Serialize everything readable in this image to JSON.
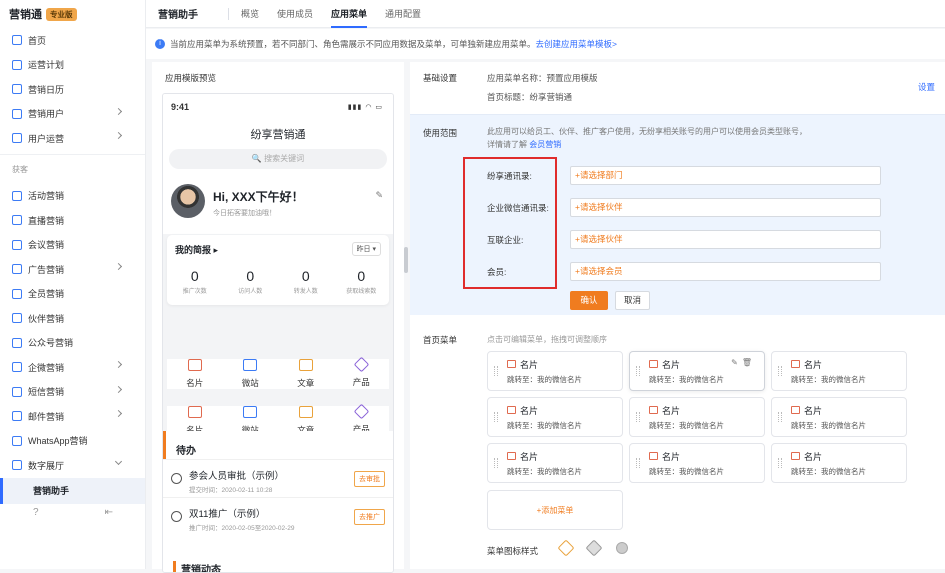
{
  "brand": {
    "name": "营销通",
    "badge": "专业版"
  },
  "sidebar": {
    "items": [
      {
        "label": "首页"
      },
      {
        "label": "运营计划"
      },
      {
        "label": "营销日历"
      },
      {
        "label": "营销用户",
        "chev": true
      },
      {
        "label": "用户运营",
        "chev": true
      }
    ],
    "group": "获客",
    "items2": [
      {
        "label": "活动营销"
      },
      {
        "label": "直播营销"
      },
      {
        "label": "会议营销"
      },
      {
        "label": "广告营销",
        "chev": true
      },
      {
        "label": "全员营销"
      },
      {
        "label": "伙伴营销"
      },
      {
        "label": "公众号营销"
      },
      {
        "label": "企微营销",
        "chev": true
      },
      {
        "label": "短信营销",
        "chev": true
      },
      {
        "label": "邮件营销",
        "chev": true
      },
      {
        "label": "WhatsApp营销"
      },
      {
        "label": "数字展厅",
        "chev": true
      }
    ],
    "sub": "营销助手",
    "foot": {
      "help": "?",
      "collapse": "⇤"
    }
  },
  "topbar": {
    "title": "营销助手",
    "tabs": [
      "概览",
      "使用成员",
      "应用菜单",
      "通用配置"
    ],
    "active": 2
  },
  "notice": {
    "text": "当前应用菜单为系统预置，若不同部门、角色需展示不同应用数据及菜单，可单独新建应用菜单。",
    "link": "去创建应用菜单模板>"
  },
  "preview": {
    "caption": "应用模版预览",
    "time": "9:41",
    "status": "▮▮▮ ◠ ▭",
    "title": "纷享营销通",
    "search": "🔍 搜索关键词",
    "greet": "Hi, XXX下午好！",
    "greet_sub": "今日拓客要加油哦！",
    "brief": {
      "title": "我的简报 ▸",
      "select": "昨日 ▾",
      "stats": [
        {
          "v": "0",
          "l": "推广次数"
        },
        {
          "v": "0",
          "l": "访问人数"
        },
        {
          "v": "0",
          "l": "转发人数"
        },
        {
          "v": "0",
          "l": "获取线索数"
        }
      ]
    },
    "grid": [
      [
        "名片",
        "微站",
        "文章",
        "产品"
      ],
      [
        "名片",
        "微站",
        "文章",
        "产品"
      ]
    ],
    "todo": {
      "title": "待办",
      "items": [
        {
          "t": "参会人员审批（示例）",
          "s": "提交时间：2020-02-11 10:28",
          "btn": "去审批"
        },
        {
          "t": "双11推广（示例）",
          "s": "推广时间：2020-02-05至2020-02-29",
          "btn": "去推广"
        }
      ]
    },
    "dynamic": "营销动态"
  },
  "settings": {
    "base_label": "基础设置",
    "name_line": "应用菜单名称：预置应用模版",
    "home_line": "首页标题：纷享营销通",
    "set_link": "设置",
    "scope_label": "使用范围",
    "scope_desc1": "此应用可以给员工、伙伴、推广客户使用，无纷享相关账号的用户可以使用会员类型账号，",
    "scope_desc2": "详情请了解",
    "scope_link": "会员营销",
    "fields": [
      {
        "label": "纷享通讯录:",
        "value": "+请选择部门"
      },
      {
        "label": "企业微信通讯录:",
        "value": "+请选择伙伴"
      },
      {
        "label": "互联企业:",
        "value": "+请选择伙伴"
      },
      {
        "label": "会员:",
        "value": "+请选择会员"
      }
    ],
    "ok": "确认",
    "cancel": "取消",
    "menu_label": "首页菜单",
    "menu_hint": "点击可编辑菜单，拖拽可调整顺序",
    "card_title": "名片",
    "card_sub": "跳转至：我的微信名片",
    "card_actions": "✎🗑",
    "add": "+添加菜单",
    "style_label": "菜单图标样式"
  },
  "colors": {
    "accent": "#2f6bff",
    "orange": "#f07c1f",
    "highlight": "#e02c2c"
  }
}
